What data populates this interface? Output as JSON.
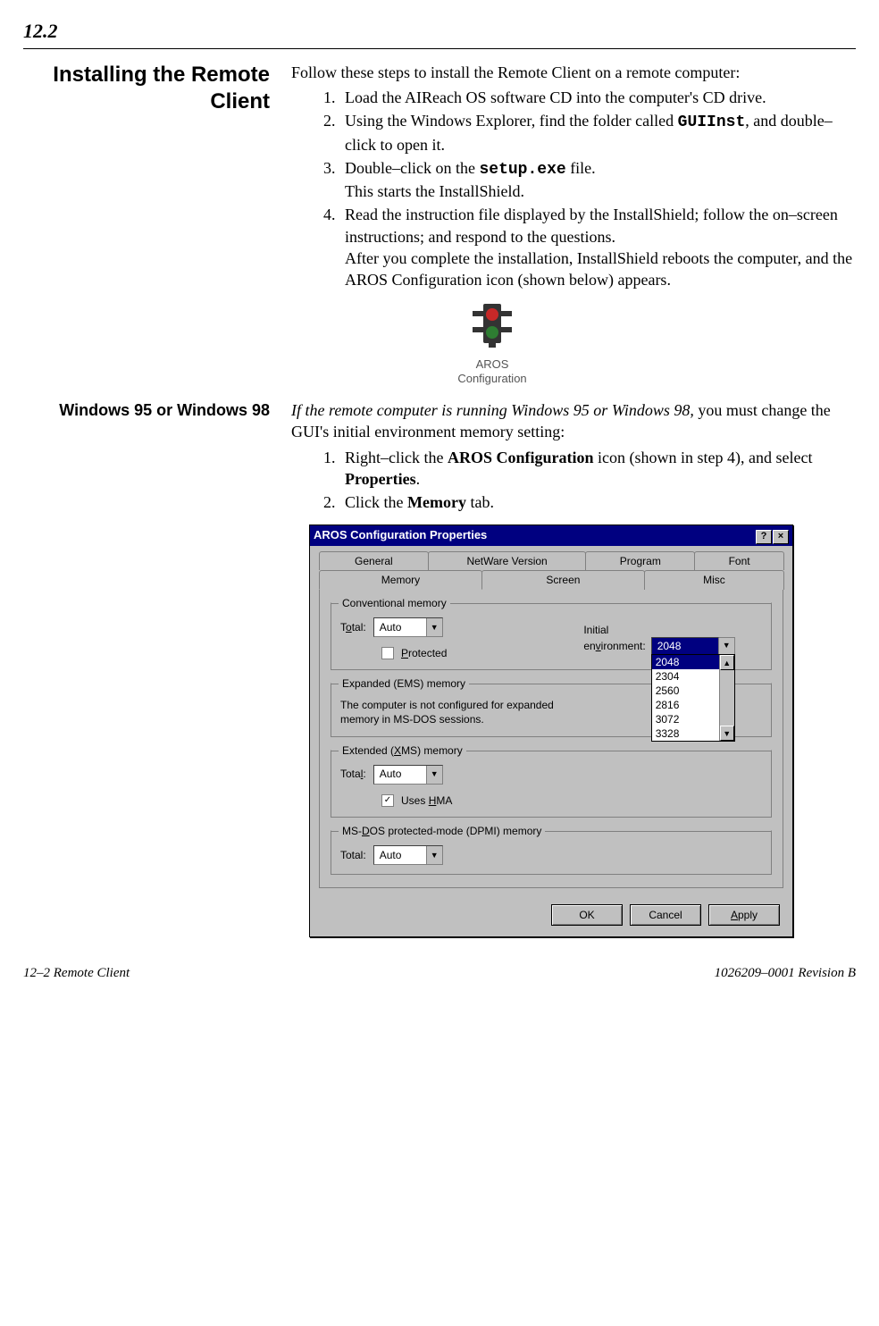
{
  "page_header": {
    "section_number": "12.2"
  },
  "section1": {
    "heading": "Installing the Remote Client",
    "intro": "Follow these steps to install the Remote Client on a remote computer:",
    "steps": {
      "s1": "Load the AIReach OS software CD into the computer's CD drive.",
      "s2a": "Using the Windows Explorer, find the folder called ",
      "s2_code": "GUIInst",
      "s2b": ", and double–click to open it.",
      "s3a": "Double–click on the ",
      "s3_code": "setup.exe",
      "s3b": " file.",
      "s3_sub": "This starts the InstallShield.",
      "s4": "Read the instruction file displayed by the InstallShield; follow the on–screen instructions; and respond to the questions.",
      "s4_sub": "After you complete the installation, InstallShield reboots the computer, and the AROS Configuration icon (shown below) appears."
    },
    "icon_label1": "AROS",
    "icon_label2": "Configuration"
  },
  "section2": {
    "heading": "Windows 95 or Windows 98",
    "intro_italic": "If the remote computer is running Windows 95 or Windows 98,",
    "intro_rest": " you must change the GUI's initial environment memory setting:",
    "steps": {
      "s1a": "Right–click the ",
      "s1b": "AROS Configuration",
      "s1c": " icon (shown in step 4), and select ",
      "s1d": "Properties",
      "s1e": ".",
      "s2a": "Click the ",
      "s2b": "Memory",
      "s2c": " tab."
    }
  },
  "dialog": {
    "title": "AROS Configuration Properties",
    "help_btn": "?",
    "close_btn": "×",
    "tabs_row1": {
      "t1": "General",
      "t2": "NetWare Version",
      "t3": "Program",
      "t4": "Font"
    },
    "tabs_row2": {
      "t1": "Memory",
      "t2": "Screen",
      "t3": "Misc"
    },
    "conventional": {
      "legend": "Conventional memory",
      "total_label_pre": "T",
      "total_label_u": "o",
      "total_label_post": "tal:",
      "total_value": "Auto",
      "env_label1": "Initial",
      "env_label2_pre": "en",
      "env_label2_u": "v",
      "env_label2_post": "ironment:",
      "env_value": "2048",
      "options": {
        "o1": "2048",
        "o2": "2304",
        "o3": "2560",
        "o4": "2816",
        "o5": "3072",
        "o6": "3328"
      },
      "protected_u": "P",
      "protected_rest": "rotected"
    },
    "ems": {
      "legend": "Expanded (EMS) memory",
      "text": "The computer is not configured for expanded memory in MS-DOS sessions."
    },
    "xms": {
      "legend_pre": "Extended (",
      "legend_u": "X",
      "legend_post": "MS) memory",
      "total_label_pre": "Tota",
      "total_label_u": "l",
      "total_label_post": ":",
      "total_value": "Auto",
      "hma_pre": "Uses ",
      "hma_u": "H",
      "hma_post": "MA",
      "hma_check": "✓"
    },
    "dpmi": {
      "legend_pre": "MS-",
      "legend_u": "D",
      "legend_post": "OS protected-mode (DPMI) memory",
      "total_label_pre": "Total",
      "total_label_u": "",
      "total_label_post": ":",
      "total_value": "Auto"
    },
    "buttons": {
      "ok": "OK",
      "cancel": "Cancel",
      "apply_u": "A",
      "apply_rest": "pply"
    }
  },
  "footer": {
    "left": "12–2  Remote Client",
    "right": "1026209–0001  Revision B"
  }
}
